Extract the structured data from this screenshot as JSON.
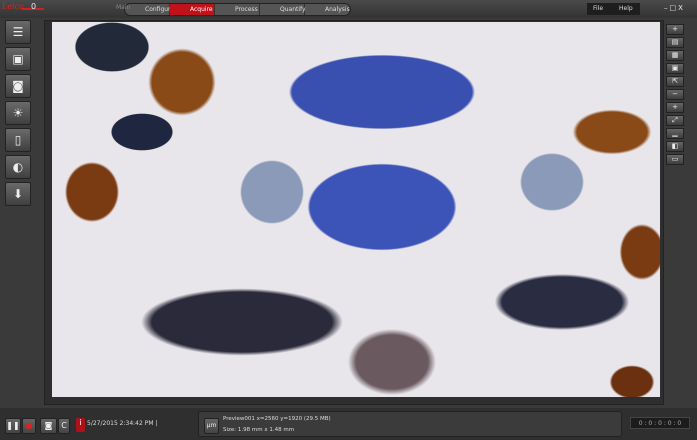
{
  "header": {
    "logo": "Leica",
    "slider_value": "0",
    "workspace": "Main",
    "workflow": [
      {
        "label": "Configuration"
      },
      {
        "label": "Acquire",
        "active": true
      },
      {
        "label": "Process"
      },
      {
        "label": "Quantify"
      },
      {
        "label": "Analysis"
      }
    ],
    "menu": [
      "File",
      "Help"
    ],
    "window_controls": "–□X"
  },
  "left_toolbar": [
    "document-icon",
    "image-browser-icon",
    "camera-icon",
    "illumination-icon",
    "filter-icon",
    "brightness-contrast-icon",
    "download-icon"
  ],
  "right_toolbar": [
    "add-icon",
    "layout-icon",
    "grid-icon",
    "save-icon",
    "export-icon",
    "zoom-out-icon",
    "zoom-in-icon",
    "fit-icon",
    "histogram-icon",
    "compare-icon",
    "overlay-icon"
  ],
  "status": {
    "timestamp": "5/27/2015 2:34:42 PM |",
    "unit_button": "µm",
    "image_info": "Preview001 x=2560 y=1920  (29.5 MB)",
    "image_size": "Size: 1.98 mm x 1.48 mm",
    "timer": "0 : 0 : 0 : 0 : 0"
  },
  "colors": {
    "accent": "#c0121a"
  }
}
